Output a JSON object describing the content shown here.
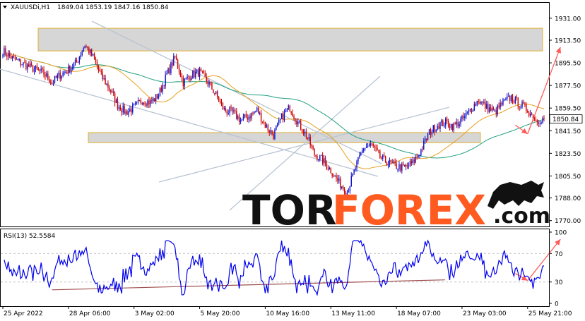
{
  "header": {
    "symbol": "XAUUSDi,H1",
    "ohlc": "1849.04 1853.19 1847.16 1850.84",
    "rsi_label": "RSI(13) 52.5584"
  },
  "brand": {
    "tor": "TOR",
    "forex": "FOREX",
    "com": ".com"
  },
  "colors": {
    "bull": "#1010cc",
    "bear": "#cc0000",
    "ma_fast": "#e6a020",
    "ma_slow": "#20a080",
    "channel": "#b8c4d4",
    "zone_fill": "#d6d6d6",
    "zone_border": "#e0b030",
    "arrow": "#ff5a5a",
    "rsi": "#0000ee",
    "rsi_trend": "#a05050",
    "brand_orange": "#ff5a1f"
  },
  "chart_data": [
    {
      "type": "candlestick",
      "title": "XAUUSDi,H1",
      "ylim": [
        1767,
        1941
      ],
      "y_ticks": [
        "1931.00",
        "1913.50",
        "1895.50",
        "1877.50",
        "1859.50",
        "1841.50",
        "1823.50",
        "1805.50",
        "1788.00",
        "1770.00"
      ],
      "y_tick_values": [
        1931,
        1913.5,
        1895.5,
        1877.5,
        1859.5,
        1841.5,
        1823.5,
        1805.5,
        1788,
        1770
      ],
      "last_price": "1850.84",
      "last_price_value": 1850.84,
      "x_labels": [
        "25 Apr 2022",
        "28 Apr 06:00",
        "3 May 02:00",
        "5 May 20:00",
        "10 May 16:00",
        "13 May 11:00",
        "18 May 07:00",
        "23 May 03:00",
        "25 May 21:00"
      ],
      "x_label_positions": [
        0,
        8,
        16,
        24,
        32,
        40,
        48,
        56,
        64
      ],
      "n_bars": 67,
      "close_path": [
        1905,
        1900,
        1896,
        1893,
        1890,
        1887,
        1880,
        1886,
        1890,
        1896,
        1910,
        1900,
        1885,
        1875,
        1862,
        1856,
        1860,
        1866,
        1864,
        1870,
        1886,
        1900,
        1880,
        1886,
        1888,
        1880,
        1870,
        1858,
        1856,
        1850,
        1853,
        1858,
        1846,
        1838,
        1852,
        1860,
        1848,
        1838,
        1823,
        1818,
        1810,
        1800,
        1793,
        1812,
        1828,
        1830,
        1820,
        1816,
        1813,
        1812,
        1816,
        1826,
        1840,
        1846,
        1848,
        1845,
        1850,
        1858,
        1866,
        1860,
        1856,
        1864,
        1868,
        1863,
        1858,
        1850,
        1850.84
      ],
      "zones": [
        {
          "from": 1905,
          "to": 1923
        },
        {
          "from": 1832,
          "to": 1840
        }
      ],
      "projection": [
        {
          "x": 64,
          "y": 1839
        },
        {
          "x": 68,
          "y": 1908
        }
      ],
      "down_arrow": [
        {
          "x": 62.5,
          "y": 1846
        },
        {
          "x": 64,
          "y": 1839
        }
      ],
      "ma_fast_period": 20,
      "ma_slow_period": 50
    },
    {
      "type": "line",
      "title": "RSI(13) 52.5584",
      "ylim": [
        0,
        100
      ],
      "y_ticks": [
        "100",
        "70",
        "30",
        "0"
      ],
      "y_tick_values": [
        100,
        70,
        30,
        0
      ],
      "levels": [
        70,
        30
      ],
      "current": 52.5584,
      "trendline": [
        {
          "x": 6,
          "y": 19
        },
        {
          "x": 76,
          "y": 33
        }
      ],
      "projection": [
        {
          "x": 64,
          "y": 32
        },
        {
          "x": 68,
          "y": 90
        }
      ],
      "down_arrow": [
        {
          "x": 62.5,
          "y": 42
        },
        {
          "x": 64,
          "y": 32
        }
      ]
    }
  ]
}
